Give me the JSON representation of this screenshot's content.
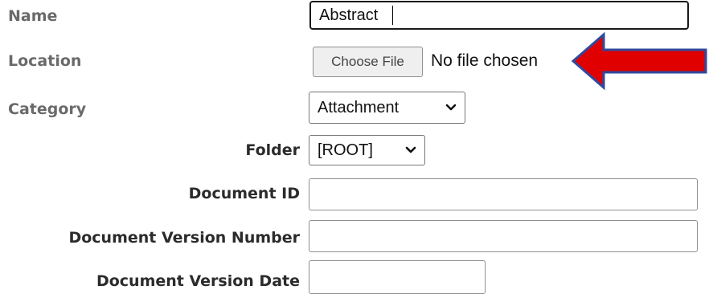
{
  "form": {
    "name_label": "Name",
    "name_value": "Abstract",
    "location_label": "Location",
    "choose_file_label": "Choose File",
    "no_file_text": "No file chosen",
    "category_label": "Category",
    "category_value": "Attachment",
    "folder_label": "Folder",
    "folder_value": "[ROOT]",
    "document_id_label": "Document ID",
    "document_id_value": "",
    "document_version_number_label": "Document Version Number",
    "document_version_number_value": "",
    "document_version_date_label": "Document Version Date",
    "document_version_date_value": ""
  },
  "annotation": {
    "arrow_color": "#e00000",
    "arrow_outline_color": "#2e4a9e",
    "arrow_icon": "left-arrow-icon"
  },
  "colors": {
    "label_gray": "#6a6a6a",
    "label_dark": "#2b2b2b"
  }
}
